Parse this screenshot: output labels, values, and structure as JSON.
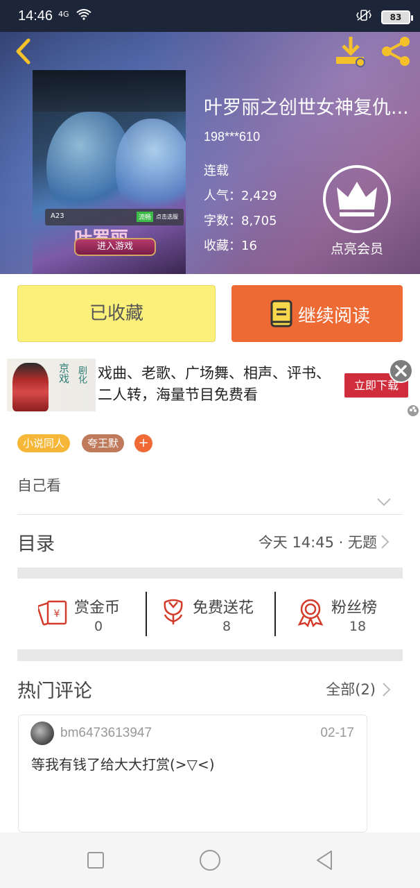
{
  "status_bar": {
    "time": "14:46",
    "signal": "4G",
    "battery": "83"
  },
  "book": {
    "title": "叶罗丽之创世女神复仇...",
    "author": "198***610",
    "status": "连载",
    "popularity_label": "人气：",
    "popularity": "2,429",
    "words_label": "字数：",
    "words": "8,705",
    "favorites_label": "收藏：",
    "favorites": "16"
  },
  "cover": {
    "badge": "A23",
    "tag": "流畅",
    "small_text": "点击选服",
    "title": "叶罗丽",
    "button": "进入游戏"
  },
  "vip": {
    "label": "点亮会员"
  },
  "actions": {
    "collected_label": "已收藏",
    "read_label": "继续阅读"
  },
  "ad": {
    "text": "戏曲、老歌、广场舞、相声、评书、二人转，海量节目免费看",
    "button": "立即下载",
    "image_text_1": "京戏",
    "image_text_2": "剧化"
  },
  "tags": [
    "小说同人",
    "夸王默",
    "+"
  ],
  "intro": "自己看",
  "toc": {
    "title": "目录",
    "latest": "今天 14:45 · 无题"
  },
  "stats": [
    {
      "label": "赏金币",
      "value": "0",
      "icon": "coin-envelope-icon"
    },
    {
      "label": "免费送花",
      "value": "8",
      "icon": "flower-icon"
    },
    {
      "label": "粉丝榜",
      "value": "18",
      "icon": "award-ribbon-icon"
    }
  ],
  "comments": {
    "title": "热门评论",
    "all_label": "全部(2)",
    "items": [
      {
        "user": "bm6473613947",
        "date": "02-17",
        "text": "等我有钱了给大大打赏(>▽<)"
      }
    ]
  },
  "colors": {
    "accent_orange": "#ee6a35",
    "collected_yellow": "#fbf07a",
    "ad_red": "#cf2d3c"
  }
}
